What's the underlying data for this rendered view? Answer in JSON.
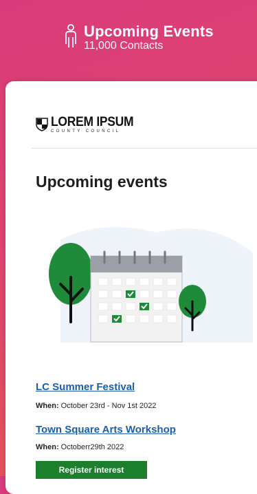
{
  "header": {
    "title": "Upcoming Events",
    "subtitle": "11,000 Contacts",
    "icon": "person-icon"
  },
  "logo": {
    "main": "LOREM IPSUM",
    "sub": "COUNTY COUNCIL",
    "icon": "shield-icon"
  },
  "section_title": "Upcoming events",
  "events": [
    {
      "title": "LC Summer Festival",
      "when_label": "When:",
      "when_value": "October 23rd - Nov 1st 2022"
    },
    {
      "title": "Town Square Arts Workshop",
      "when_label": "When:",
      "when_value": "Octoberr29th 2022"
    }
  ],
  "register_button": "Register interest",
  "colors": {
    "link": "#1a5fa8",
    "button": "#1b7f2b",
    "tree": "#1f8a3a",
    "header_gradient_start": "#d93b7b",
    "header_gradient_end": "#e45a4e"
  }
}
